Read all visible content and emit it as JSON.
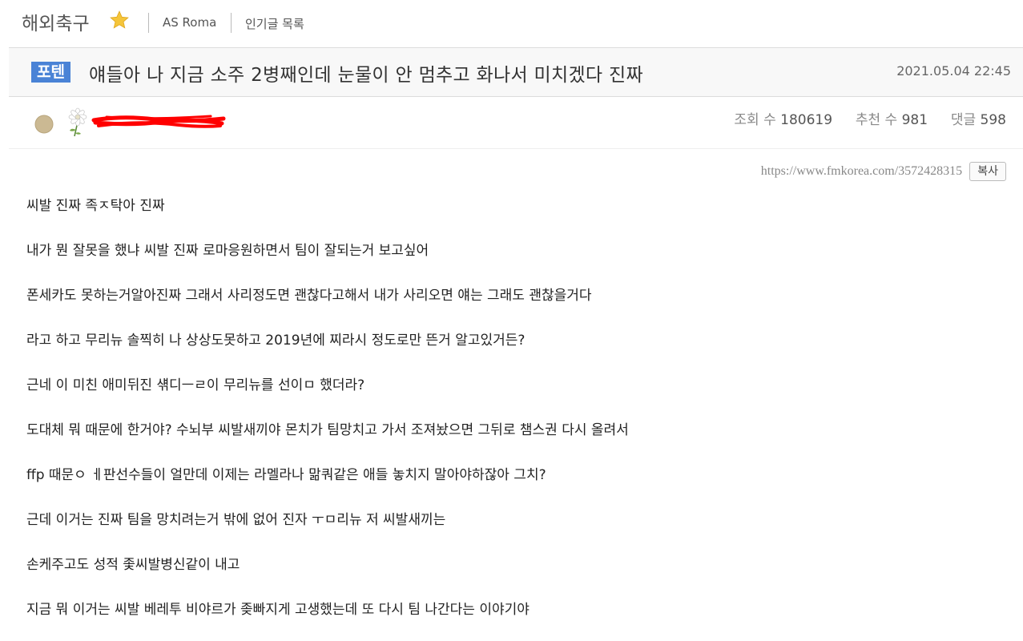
{
  "board": {
    "name": "해외축구",
    "breadcrumbs": [
      "AS Roma",
      "인기글 목록"
    ]
  },
  "post": {
    "category_badge": "포텐",
    "title": "얘들아 나 지금 소주 2병째인데 눈물이 안 멈추고 화나서 미치겠다 진짜",
    "date": "2021.05.04 22:45",
    "stats": {
      "views_label": "조회 수",
      "views": "180619",
      "likes_label": "추천 수",
      "likes": "981",
      "comments_label": "댓글",
      "comments": "598"
    },
    "url": "https://www.fmkorea.com/3572428315",
    "copy_label": "복사",
    "paragraphs": [
      "씨발 진짜 족ㅈ탁아 진짜",
      "내가 뭔 잘못을 했냐 씨발 진짜 로마응원하면서 팀이 잘되는거 보고싶어",
      "폰세카도 못하는거알아진짜 그래서 사리정도면 괜찮다고해서 내가 사리오면 얘는 그래도 괜찮을거다",
      "라고 하고 무리뉴 솔찍히 나 상상도못하고 2019년에 찌라시 정도로만 뜬거 알고있거든?",
      "근네 이 미친 애미뒤진 섂디ㅡㄹ이 무리뉴를 선이ㅁ 했더라?",
      "도대체 뭐 때문에 한거야? 수뇌부 씨발새끼야 몬치가 팀망치고 가서 조져놨으면 그뒤로 챔스권 다시 올려서",
      "ffp 때문ㅇ ㅔ판선수들이 얼만데 이제는 라멜라나 맒쿼같은 애들 놓치지 말아야하잖아 그치?",
      "근데 이거는 진짜 팀을 망치려는거 밖에 없어 진자 ㅜㅁ리뉴 저 씨발새끼는",
      "손케주고도 성적 좇씨발병신같이 내고",
      "지금 뭐 이거는 씨발 베레투 비야르가 좆빠지게 고생했는데 또 다시 팀 나간다는 이야기야"
    ]
  },
  "colors": {
    "badge_bg": "#4a83d6",
    "title_bar_bg": "#f8f8f8",
    "redaction": "#ff0000",
    "star": "#f5c53a"
  },
  "icons": [
    "star-icon",
    "level-icon",
    "flower-icon"
  ]
}
